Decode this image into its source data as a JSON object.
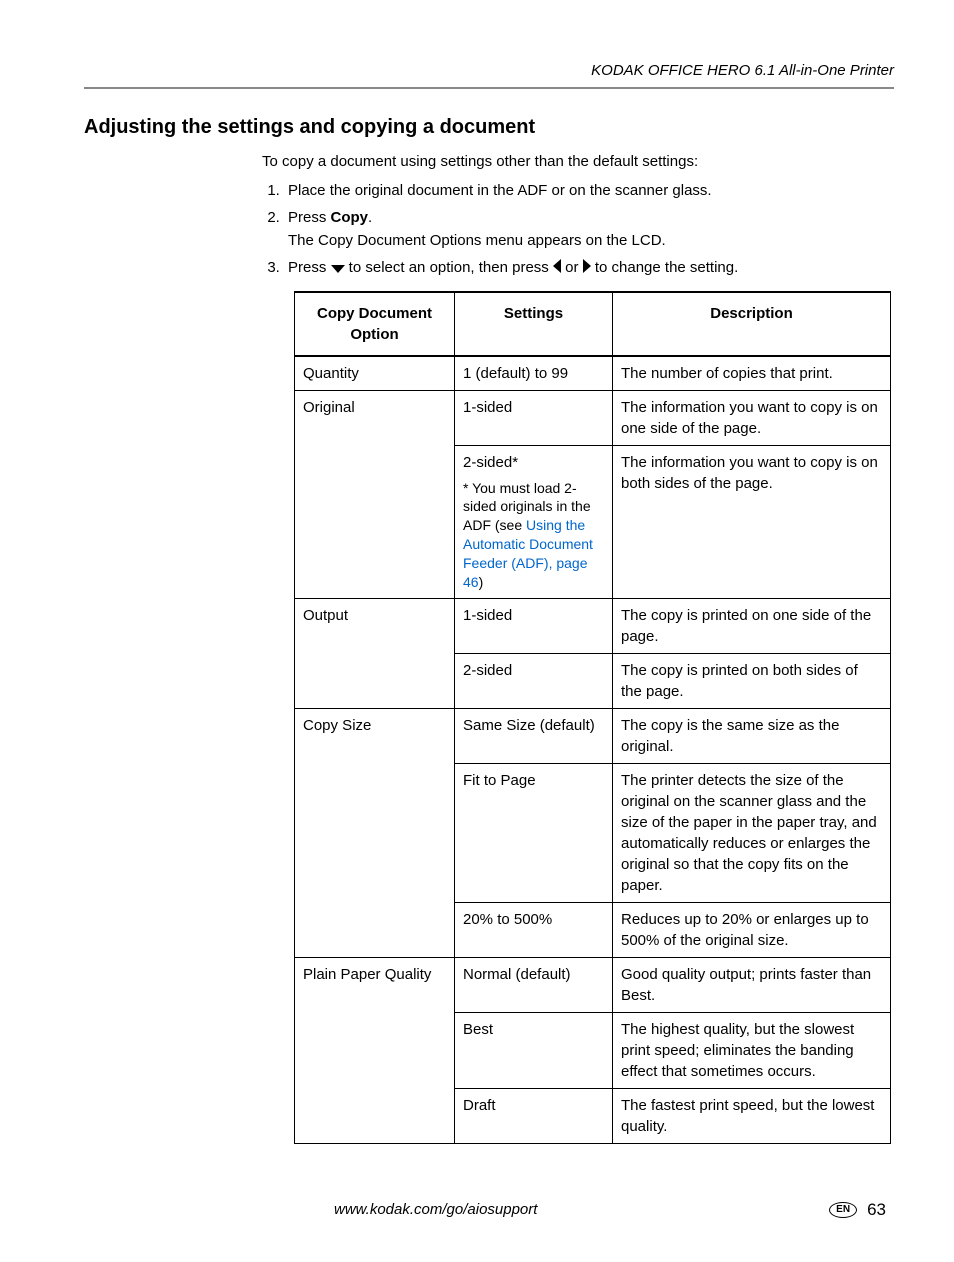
{
  "header": {
    "product": "KODAK OFFICE HERO 6.1 All-in-One Printer"
  },
  "title": "Adjusting the settings and copying a document",
  "intro": "To copy a document using settings other than the default settings:",
  "steps": {
    "s1": "Place the original document in the ADF or on the scanner glass.",
    "s2a": "Press ",
    "s2b": "Copy",
    "s2c": ".",
    "s2sub": "The Copy Document Options menu appears on the LCD.",
    "s3a": "Press ",
    "s3b": " to select an option, then press ",
    "s3c": " or ",
    "s3d": " to change the setting."
  },
  "table": {
    "headers": {
      "h1": "Copy Document Option",
      "h2": "Settings",
      "h3": "Description"
    },
    "rows": {
      "quantity": {
        "opt": "Quantity",
        "set": "1 (default) to 99",
        "desc": "The number of copies that print."
      },
      "orig1": {
        "opt": "Original",
        "set": "1-sided",
        "desc": "The information you want to copy is on one side of the page."
      },
      "orig2": {
        "set_pre": "2-sided*",
        "note_a": "* You must load 2-sided originals in the ADF (see ",
        "note_link": "Using the Automatic Document Feeder (ADF), page 46",
        "note_b": ")",
        "desc": "The information you want to copy is on both sides of the page."
      },
      "out1": {
        "opt": "Output",
        "set": "1-sided",
        "desc": "The copy is printed on one side of the page."
      },
      "out2": {
        "set": "2-sided",
        "desc": "The copy is printed on both sides of the page."
      },
      "cs1": {
        "opt": "Copy Size",
        "set": "Same Size (default)",
        "desc": "The copy is the same size as the original."
      },
      "cs2": {
        "set": "Fit to Page",
        "desc": "The printer detects the size of the original on the scanner glass and the size of the paper in the paper tray, and automatically reduces or enlarges the original so that the copy fits on the paper."
      },
      "cs3": {
        "set": "20% to 500%",
        "desc": "Reduces up to 20% or enlarges up to 500% of the original size."
      },
      "ppq1": {
        "opt": "Plain Paper Quality",
        "set": "Normal (default)",
        "desc": "Good quality output; prints faster than Best."
      },
      "ppq2": {
        "set": "Best",
        "desc": "The highest quality, but the slowest print speed; eliminates the banding effect that sometimes occurs."
      },
      "ppq3": {
        "set": "Draft",
        "desc": "The fastest print speed, but the lowest quality."
      }
    }
  },
  "footer": {
    "url": "www.kodak.com/go/aiosupport",
    "lang": "EN",
    "page": "63"
  }
}
